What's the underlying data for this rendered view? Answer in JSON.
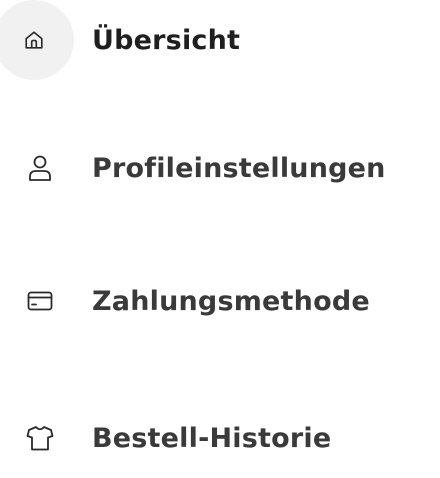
{
  "nav": {
    "items": [
      {
        "label": "Übersicht",
        "icon": "home-icon",
        "active": true
      },
      {
        "label": "Profileinstellungen",
        "icon": "user-icon",
        "active": false
      },
      {
        "label": "Zahlungsmethode",
        "icon": "credit-card-icon",
        "active": false
      },
      {
        "label": "Bestell-Historie",
        "icon": "shirt-icon",
        "active": false
      }
    ]
  },
  "colors": {
    "active_text": "#1f1f1f",
    "inactive_text": "#3a3a3a",
    "active_icon_bg": "#f1f1f1",
    "icon_stroke": "#2a2a2a"
  }
}
